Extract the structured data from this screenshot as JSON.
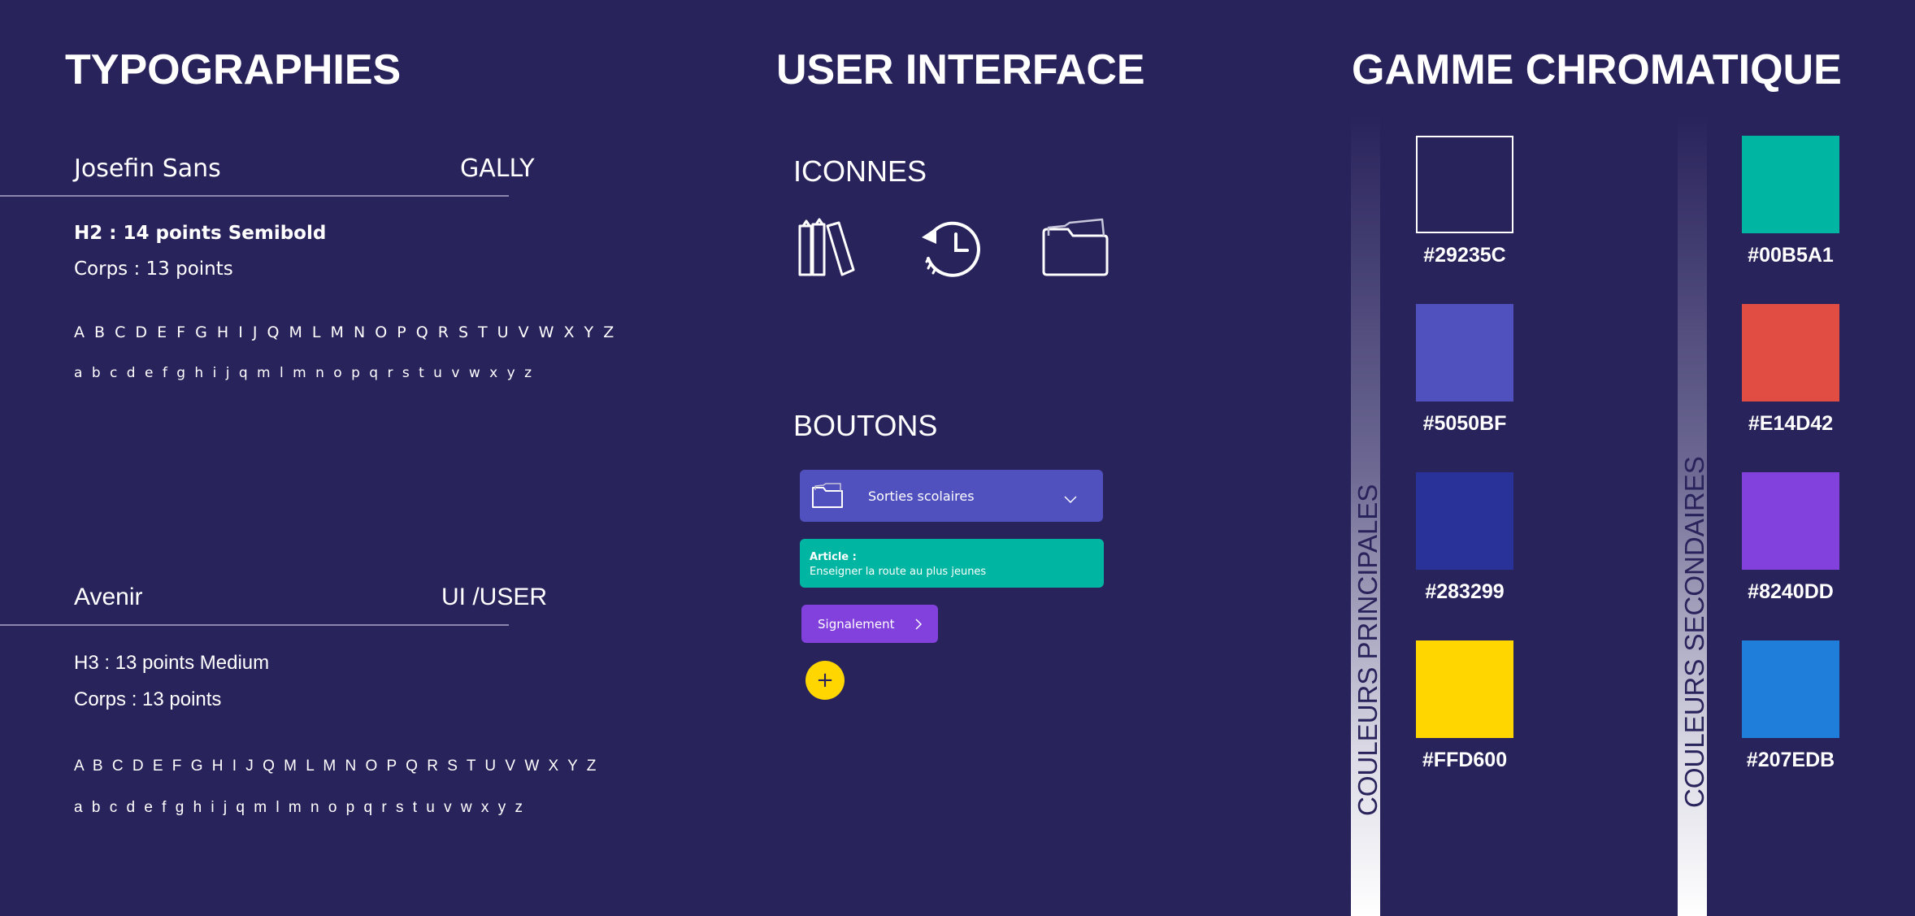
{
  "typographies": {
    "title": "TYPOGRAPHIES",
    "fonts": [
      {
        "name": "Josefin Sans",
        "usage": "GALLY",
        "heading_spec": "H2 : 14 points Semibold",
        "body_spec": "Corps : 13 points",
        "uppercase": "A B C D E F G H I J Q M L M N O P Q R S T U V W X Y Z",
        "lowercase": "a b c d e f g h i j q m l m n o p q r s t u v w x y z"
      },
      {
        "name": "Avenir",
        "usage": "UI /USER",
        "heading_spec": "H3 : 13 points Medium",
        "body_spec": "Corps : 13 points",
        "uppercase": "A B C D E F G H I J Q M L M N O P Q R S T U V W X Y Z",
        "lowercase": "a b c d e f g h i j q m l m n o p q r s t u v w x y z"
      }
    ]
  },
  "user_interface": {
    "title": "USER INTERFACE",
    "icons_title": "ICONNES",
    "icons": [
      "books-icon",
      "history-icon",
      "folder-icon"
    ],
    "buttons_title": "BOUTONS",
    "dropdown_label": "Sorties scolaires",
    "article_label": "Article :",
    "article_text": "Enseigner la route au plus jeunes",
    "signal_label": "Signalement",
    "add_label": "+"
  },
  "gamme": {
    "title": "GAMME CHROMATIQUE",
    "primary_label": "COULEURS PRINCIPALES",
    "secondary_label": "COULEURS SECONDAIRES",
    "primary": [
      "#29235C",
      "#5050BF",
      "#283299",
      "#FFD600"
    ],
    "secondary": [
      "#00B5A1",
      "#E14D42",
      "#8240DD",
      "#207EDB"
    ]
  }
}
